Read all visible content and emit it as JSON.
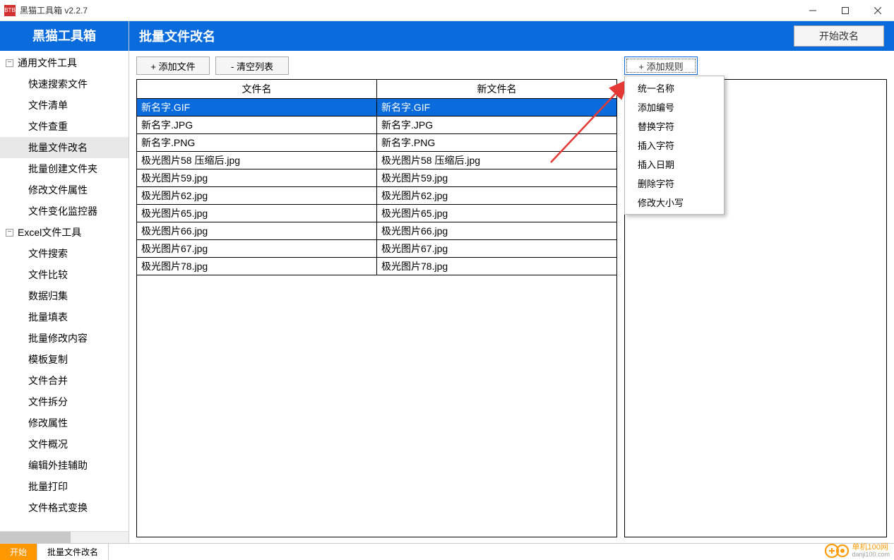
{
  "window": {
    "title": "黑猫工具箱 v2.2.7",
    "icon_text": "BTB"
  },
  "sidebar": {
    "header": "黑猫工具箱",
    "groups": [
      {
        "label": "通用文件工具",
        "items": [
          "快速搜索文件",
          "文件清单",
          "文件查重",
          "批量文件改名",
          "批量创建文件夹",
          "修改文件属性",
          "文件变化监控器"
        ],
        "active_index": 3
      },
      {
        "label": "Excel文件工具",
        "items": [
          "文件搜索",
          "文件比较",
          "数据归集",
          "批量填表",
          "批量修改内容",
          "模板复制",
          "文件合并",
          "文件拆分",
          "修改属性",
          "文件概况",
          "编辑外挂辅助",
          "批量打印",
          "文件格式变换"
        ]
      }
    ]
  },
  "main": {
    "title": "批量文件改名",
    "start_button": "开始改名",
    "toolbar": {
      "add_file": "+ 添加文件",
      "clear_list": "- 清空列表"
    },
    "table": {
      "cols": [
        "文件名",
        "新文件名"
      ],
      "rows": [
        [
          "新名字.GIF",
          "新名字.GIF"
        ],
        [
          "新名字.JPG",
          "新名字.JPG"
        ],
        [
          "新名字.PNG",
          "新名字.PNG"
        ],
        [
          "极光图片58 压缩后.jpg",
          "极光图片58 压缩后.jpg"
        ],
        [
          "极光图片59.jpg",
          "极光图片59.jpg"
        ],
        [
          "极光图片62.jpg",
          "极光图片62.jpg"
        ],
        [
          "极光图片65.jpg",
          "极光图片65.jpg"
        ],
        [
          "极光图片66.jpg",
          "极光图片66.jpg"
        ],
        [
          "极光图片67.jpg",
          "极光图片67.jpg"
        ],
        [
          "极光图片78.jpg",
          "极光图片78.jpg"
        ]
      ],
      "selected": 0
    }
  },
  "rules": {
    "add_button": "+ 添加规则",
    "menu": [
      "统一名称",
      "添加编号",
      "替换字符",
      "插入字符",
      "插入日期",
      "删除字符",
      "修改大小写"
    ]
  },
  "bottom_tabs": {
    "items": [
      "开始",
      "批量文件改名"
    ],
    "active": 0
  },
  "watermark": {
    "name": "单机100网",
    "url": "danji100.com"
  }
}
